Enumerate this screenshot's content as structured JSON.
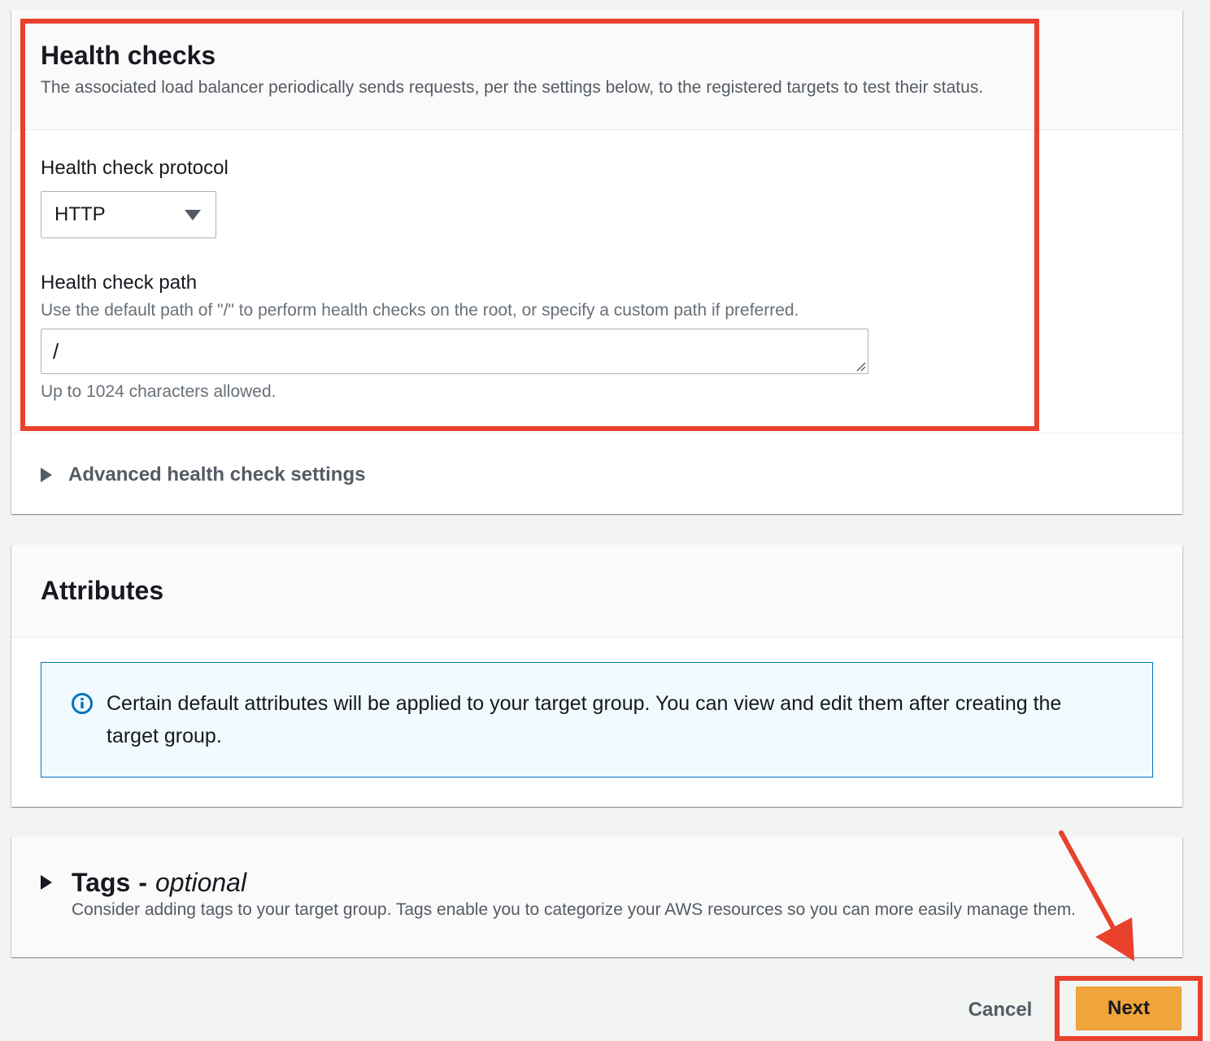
{
  "health_checks": {
    "title": "Health checks",
    "description": "The associated load balancer periodically sends requests, per the settings below, to the registered targets to test their status.",
    "protocol_label": "Health check protocol",
    "protocol_value": "HTTP",
    "path_label": "Health check path",
    "path_hint": "Use the default path of \"/\" to perform health checks on the root, or specify a custom path if preferred.",
    "path_value": "/",
    "path_constraint": "Up to 1024 characters allowed.",
    "advanced_label": "Advanced health check settings"
  },
  "attributes": {
    "title": "Attributes",
    "info_text": "Certain default attributes will be applied to your target group. You can view and edit them after creating the target group."
  },
  "tags": {
    "title": "Tags",
    "separator": "-",
    "optional": "optional",
    "description": "Consider adding tags to your target group. Tags enable you to categorize your AWS resources so you can more easily manage them."
  },
  "footer": {
    "cancel_label": "Cancel",
    "next_label": "Next"
  },
  "colors": {
    "annotation_red": "#e8412c",
    "primary_button": "#f0a43c",
    "info_border": "#0073bb",
    "info_background": "#f1faff"
  },
  "icons": {
    "info": "info-circle-icon",
    "caret": "caret-down-icon",
    "expand": "caret-right-icon"
  }
}
